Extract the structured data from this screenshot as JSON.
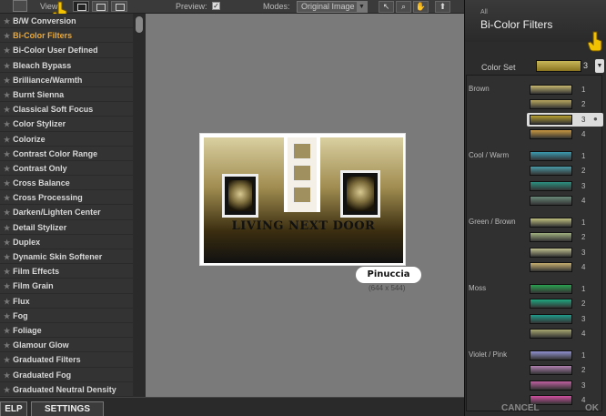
{
  "toolbar": {
    "view_label": "View:",
    "preview_label": "Preview:",
    "preview_checked": "✓",
    "modes_label": "Modes:",
    "mode_value": "Original Image"
  },
  "filters": [
    "B/W Conversion",
    "Bi-Color Filters",
    "Bi-Color User Defined",
    "Bleach Bypass",
    "Brilliance/Warmth",
    "Burnt Sienna",
    "Classical Soft Focus",
    "Color Stylizer",
    "Colorize",
    "Contrast Color Range",
    "Contrast Only",
    "Cross Balance",
    "Cross Processing",
    "Darken/Lighten Center",
    "Detail Stylizer",
    "Duplex",
    "Dynamic Skin Softener",
    "Film Effects",
    "Film Grain",
    "Flux",
    "Fog",
    "Foliage",
    "Glamour Glow",
    "Graduated Filters",
    "Graduated Fog",
    "Graduated Neutral Density"
  ],
  "active_filter_index": 1,
  "preview": {
    "image_title": "LIVING NEXT DOOR",
    "signature": "Pinuccia",
    "dimensions": "(644 x 544)"
  },
  "bottom": {
    "help_label": "ELP",
    "settings_label": "SETTINGS",
    "cancel_label": "CANCEL",
    "ok_label": "OK"
  },
  "panel": {
    "category": "All",
    "title": "Bi-Color Filters",
    "color_set_label": "Color Set",
    "color_set_value": "3",
    "selected_color": "#b8a030"
  },
  "color_groups": [
    {
      "name": "Brown",
      "swatches": [
        "#c8b870",
        "#b8a860",
        "#b8a030",
        "#c89840"
      ]
    },
    {
      "name": "Cool / Warm",
      "swatches": [
        "#3a9ab0",
        "#4a9aa8",
        "#2a9080",
        "#6a8a7a"
      ]
    },
    {
      "name": "Green / Brown",
      "swatches": [
        "#c0c080",
        "#a0b080",
        "#c0c090",
        "#c8b070"
      ]
    },
    {
      "name": "Moss",
      "swatches": [
        "#2aa050",
        "#20a880",
        "#209a8a",
        "#a8a870"
      ]
    },
    {
      "name": "Violet / Pink",
      "swatches": [
        "#9090d0",
        "#b080b0",
        "#c060a0",
        "#d050a0"
      ]
    }
  ]
}
